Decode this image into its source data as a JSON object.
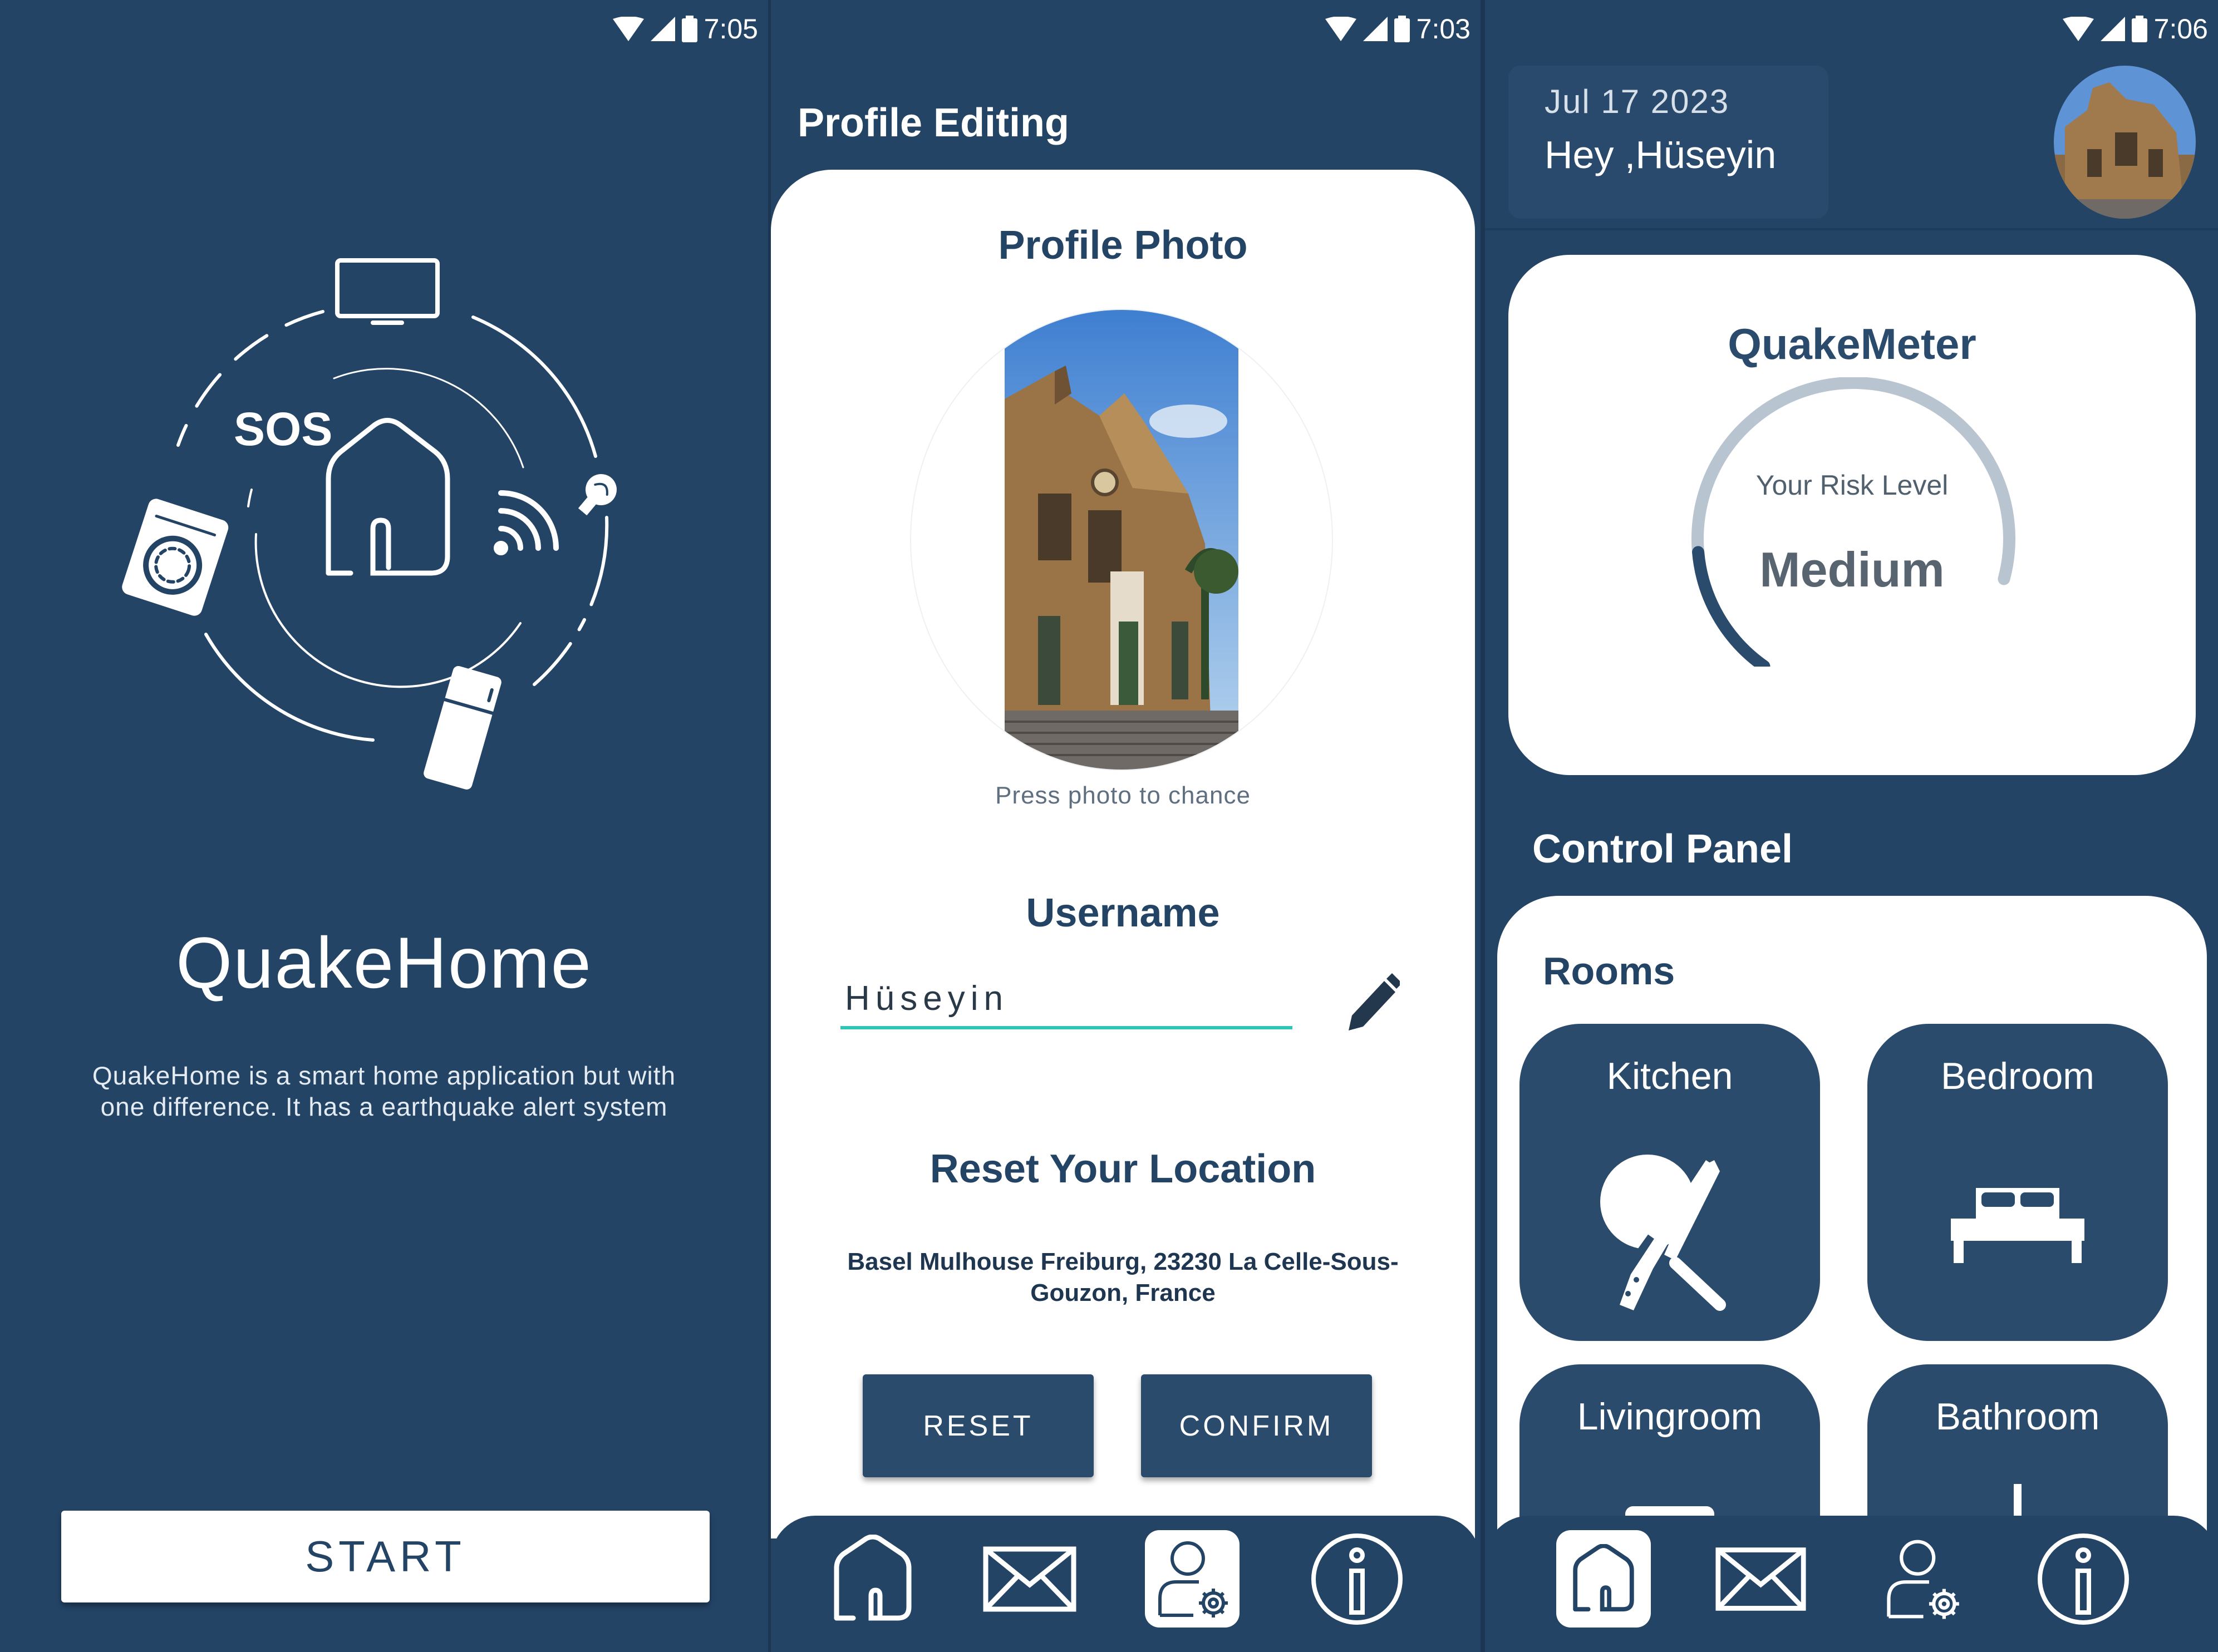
{
  "statusbars": [
    {
      "time": "7:05"
    },
    {
      "time": "7:03"
    },
    {
      "time": "7:06"
    }
  ],
  "welcome": {
    "app_name": "QuakeHome",
    "description": "QuakeHome is a smart home application but with one difference. It has a earthquake alert system",
    "sos_label": "SOS",
    "start_label": "START",
    "icons": [
      "tv-icon",
      "sos-icon",
      "home-icon",
      "wifi-icon",
      "washing-machine-icon",
      "bulb-icon",
      "fridge-icon"
    ]
  },
  "profile": {
    "header": "Profile Editing",
    "photo_title": "Profile Photo",
    "photo_hint": "Press photo to chance",
    "username_title": "Username",
    "username_value": "Hüseyin",
    "location_title": "Reset Your Location",
    "address": "Basel Mulhouse Freiburg, 23230 La Celle-Sous-Gouzon, France",
    "reset_label": "RESET",
    "confirm_label": "CONFIRM"
  },
  "dashboard": {
    "date": "Jul 17 2023",
    "greeting": "Hey ,Hüseyin",
    "quakemeter": {
      "title": "QuakeMeter",
      "label": "Your Risk Level",
      "value": "Medium",
      "level_fraction": 0.2
    },
    "control_panel_title": "Control Panel",
    "rooms_label": "Rooms",
    "rooms": [
      {
        "name": "Kitchen",
        "icon": "kitchen-icon"
      },
      {
        "name": "Bedroom",
        "icon": "bed-icon"
      },
      {
        "name": "Livingroom",
        "icon": "sofa-icon"
      },
      {
        "name": "Bathroom",
        "icon": "shower-icon"
      }
    ]
  },
  "nav": {
    "items": [
      "home-icon",
      "mail-icon",
      "profile-settings-icon",
      "info-icon"
    ],
    "profile_active": "profile-settings-icon",
    "dashboard_active": "home-icon"
  },
  "colors": {
    "primary": "#244466",
    "card": "#2b4b6d",
    "accent": "#2ec4b6",
    "gauge_track": "#b8c4cf"
  }
}
